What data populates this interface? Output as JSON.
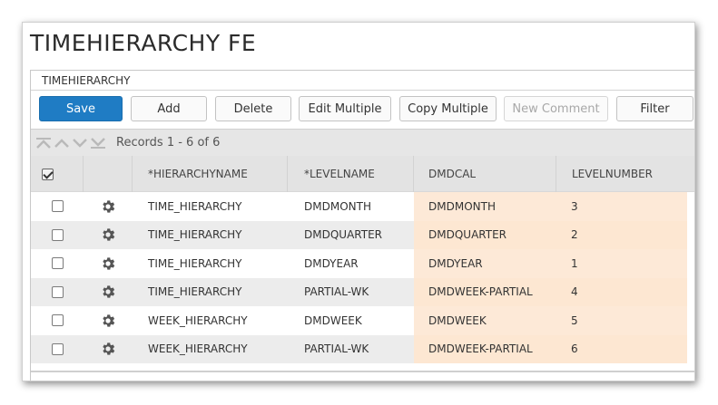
{
  "page": {
    "title": "TIMEHIERARCHY FE"
  },
  "panel": {
    "title": "TIMEHIERARCHY"
  },
  "toolbar": {
    "buttons": [
      {
        "label": "Save"
      },
      {
        "label": "Add"
      },
      {
        "label": "Delete"
      },
      {
        "label": "Edit Multiple"
      },
      {
        "label": "Copy Multiple"
      },
      {
        "label": "New Comment"
      },
      {
        "label": "Filter"
      }
    ]
  },
  "records": {
    "text": "Records 1 - 6 of 6"
  },
  "grid": {
    "columns": [
      "*HIERARCHYNAME",
      "*LEVELNAME",
      "DMDCAL",
      "LEVELNUMBER"
    ],
    "rows": [
      {
        "hierarchyname": "TIME_HIERARCHY",
        "levelname": "DMDMONTH",
        "dmdcal": "DMDMONTH",
        "levelnumber": "3"
      },
      {
        "hierarchyname": "TIME_HIERARCHY",
        "levelname": "DMDQUARTER",
        "dmdcal": "DMDQUARTER",
        "levelnumber": "2"
      },
      {
        "hierarchyname": "TIME_HIERARCHY",
        "levelname": "DMDYEAR",
        "dmdcal": "DMDYEAR",
        "levelnumber": "1"
      },
      {
        "hierarchyname": "TIME_HIERARCHY",
        "levelname": "PARTIAL-WK",
        "dmdcal": "DMDWEEK-PARTIAL",
        "levelnumber": "4"
      },
      {
        "hierarchyname": "WEEK_HIERARCHY",
        "levelname": "DMDWEEK",
        "dmdcal": "DMDWEEK",
        "levelnumber": "5"
      },
      {
        "hierarchyname": "WEEK_HIERARCHY",
        "levelname": "PARTIAL-WK",
        "dmdcal": "DMDWEEK-PARTIAL",
        "levelnumber": "6"
      }
    ]
  },
  "colors": {
    "primary": "#1f7cc4",
    "dmdcal_bg": "#fde9d7",
    "header_bg": "#e3e3e3"
  },
  "icons": {
    "nav": [
      "first-page-icon",
      "prev-page-icon",
      "next-page-icon",
      "last-page-icon"
    ],
    "row_action": "gear-icon"
  }
}
